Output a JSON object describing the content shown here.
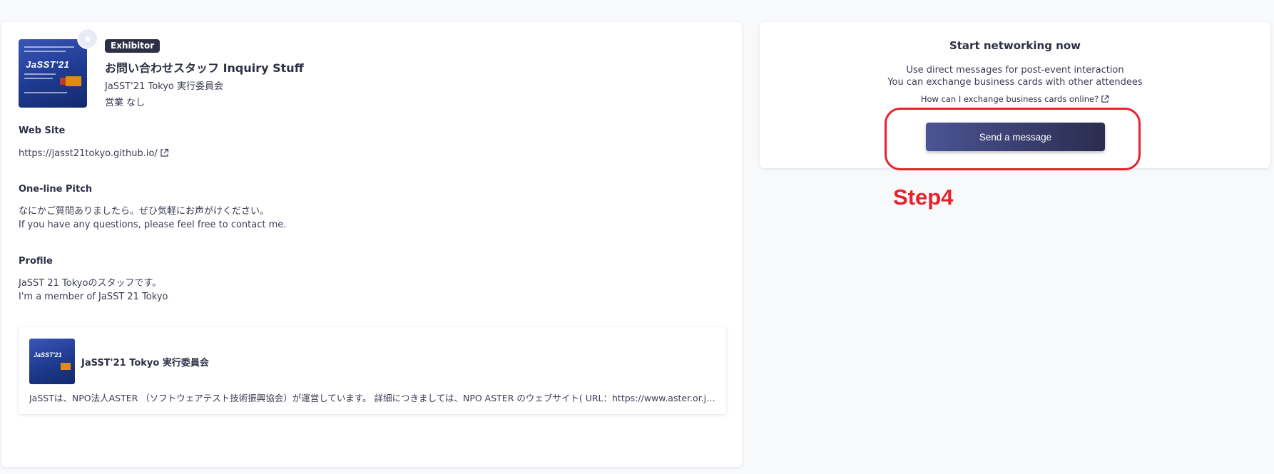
{
  "profile": {
    "badge": "Exhibitor",
    "name": "お問い合わせスタッフ Inquiry Stuff",
    "organization": "JaSST'21 Tokyo 実行委員会",
    "role": "営業 なし"
  },
  "website": {
    "heading": "Web Site",
    "url": "https://jasst21tokyo.github.io/"
  },
  "pitch": {
    "heading": "One-line Pitch",
    "line1": "なにかご質問ありましたら。ぜひ気軽にお声がけください。",
    "line2": "If you have any questions, please feel free to contact me."
  },
  "profile_section": {
    "heading": "Profile",
    "line1": "JaSST 21 Tokyoのスタッフです。",
    "line2": "I'm a member of JaSST 21 Tokyo"
  },
  "company": {
    "name": "JaSST'21 Tokyo 実行委員会",
    "description": "JaSSTは、NPO法人ASTER （ソフトウェアテスト技術振興協会）が運営しています。 詳細につきましては、NPO ASTER のウェブサイト( URL：https://www.aster.or.jp/ )をご覧ください。"
  },
  "networking": {
    "title": "Start networking now",
    "line1": "Use direct messages for post-event interaction",
    "line2": "You can exchange business cards with other attendees",
    "help_link": "How can I exchange business cards online?",
    "button": "Send a message"
  },
  "annotation": {
    "label": "Step4",
    "color": "#e8212b"
  },
  "colors": {
    "badge_bg": "#2d2f45",
    "button_start": "#4b5494",
    "button_end": "#2b2d4e"
  },
  "icons": [
    "star-icon",
    "external-link-icon"
  ]
}
